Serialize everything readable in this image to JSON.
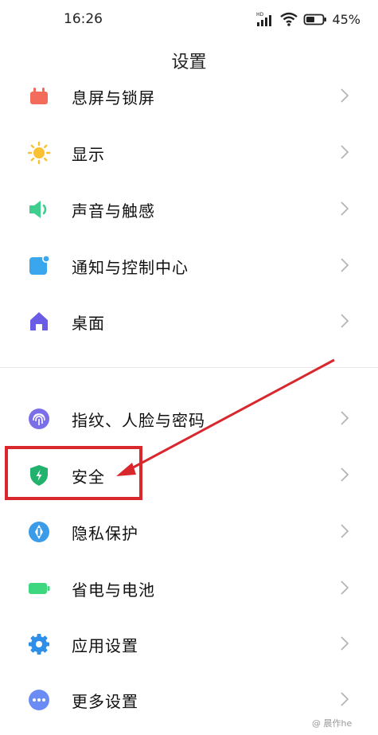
{
  "status_bar": {
    "time": "16:26",
    "battery": "45%",
    "network_badge": "HD"
  },
  "page": {
    "title": "设置"
  },
  "groups": [
    {
      "items": [
        {
          "label": "息屏与锁屏",
          "icon": "lock-screen-icon",
          "color": "#f26b5b"
        },
        {
          "label": "显示",
          "icon": "sun-icon",
          "color": "#f9c131"
        },
        {
          "label": "声音与触感",
          "icon": "speaker-icon",
          "color": "#3ecf8e"
        },
        {
          "label": "通知与控制中心",
          "icon": "notification-icon",
          "color": "#3aa6ee"
        },
        {
          "label": "桌面",
          "icon": "home-icon",
          "color": "#6b5ce7"
        }
      ]
    },
    {
      "items": [
        {
          "label": "指纹、人脸与密码",
          "icon": "fingerprint-icon",
          "color": "#7b6fe9"
        },
        {
          "label": "安全",
          "icon": "security-shield-icon",
          "color": "#21b26d"
        },
        {
          "label": "隐私保护",
          "icon": "privacy-icon",
          "color": "#3a9be8"
        },
        {
          "label": "省电与电池",
          "icon": "battery-icon",
          "color": "#3ed67f"
        },
        {
          "label": "应用设置",
          "icon": "gear-icon",
          "color": "#2f8fe8"
        },
        {
          "label": "更多设置",
          "icon": "more-icon",
          "color": "#6b8cf5"
        }
      ]
    }
  ],
  "annotation": {
    "color": "#d9272e",
    "target": "安全"
  },
  "watermark": "@ 晨作he"
}
